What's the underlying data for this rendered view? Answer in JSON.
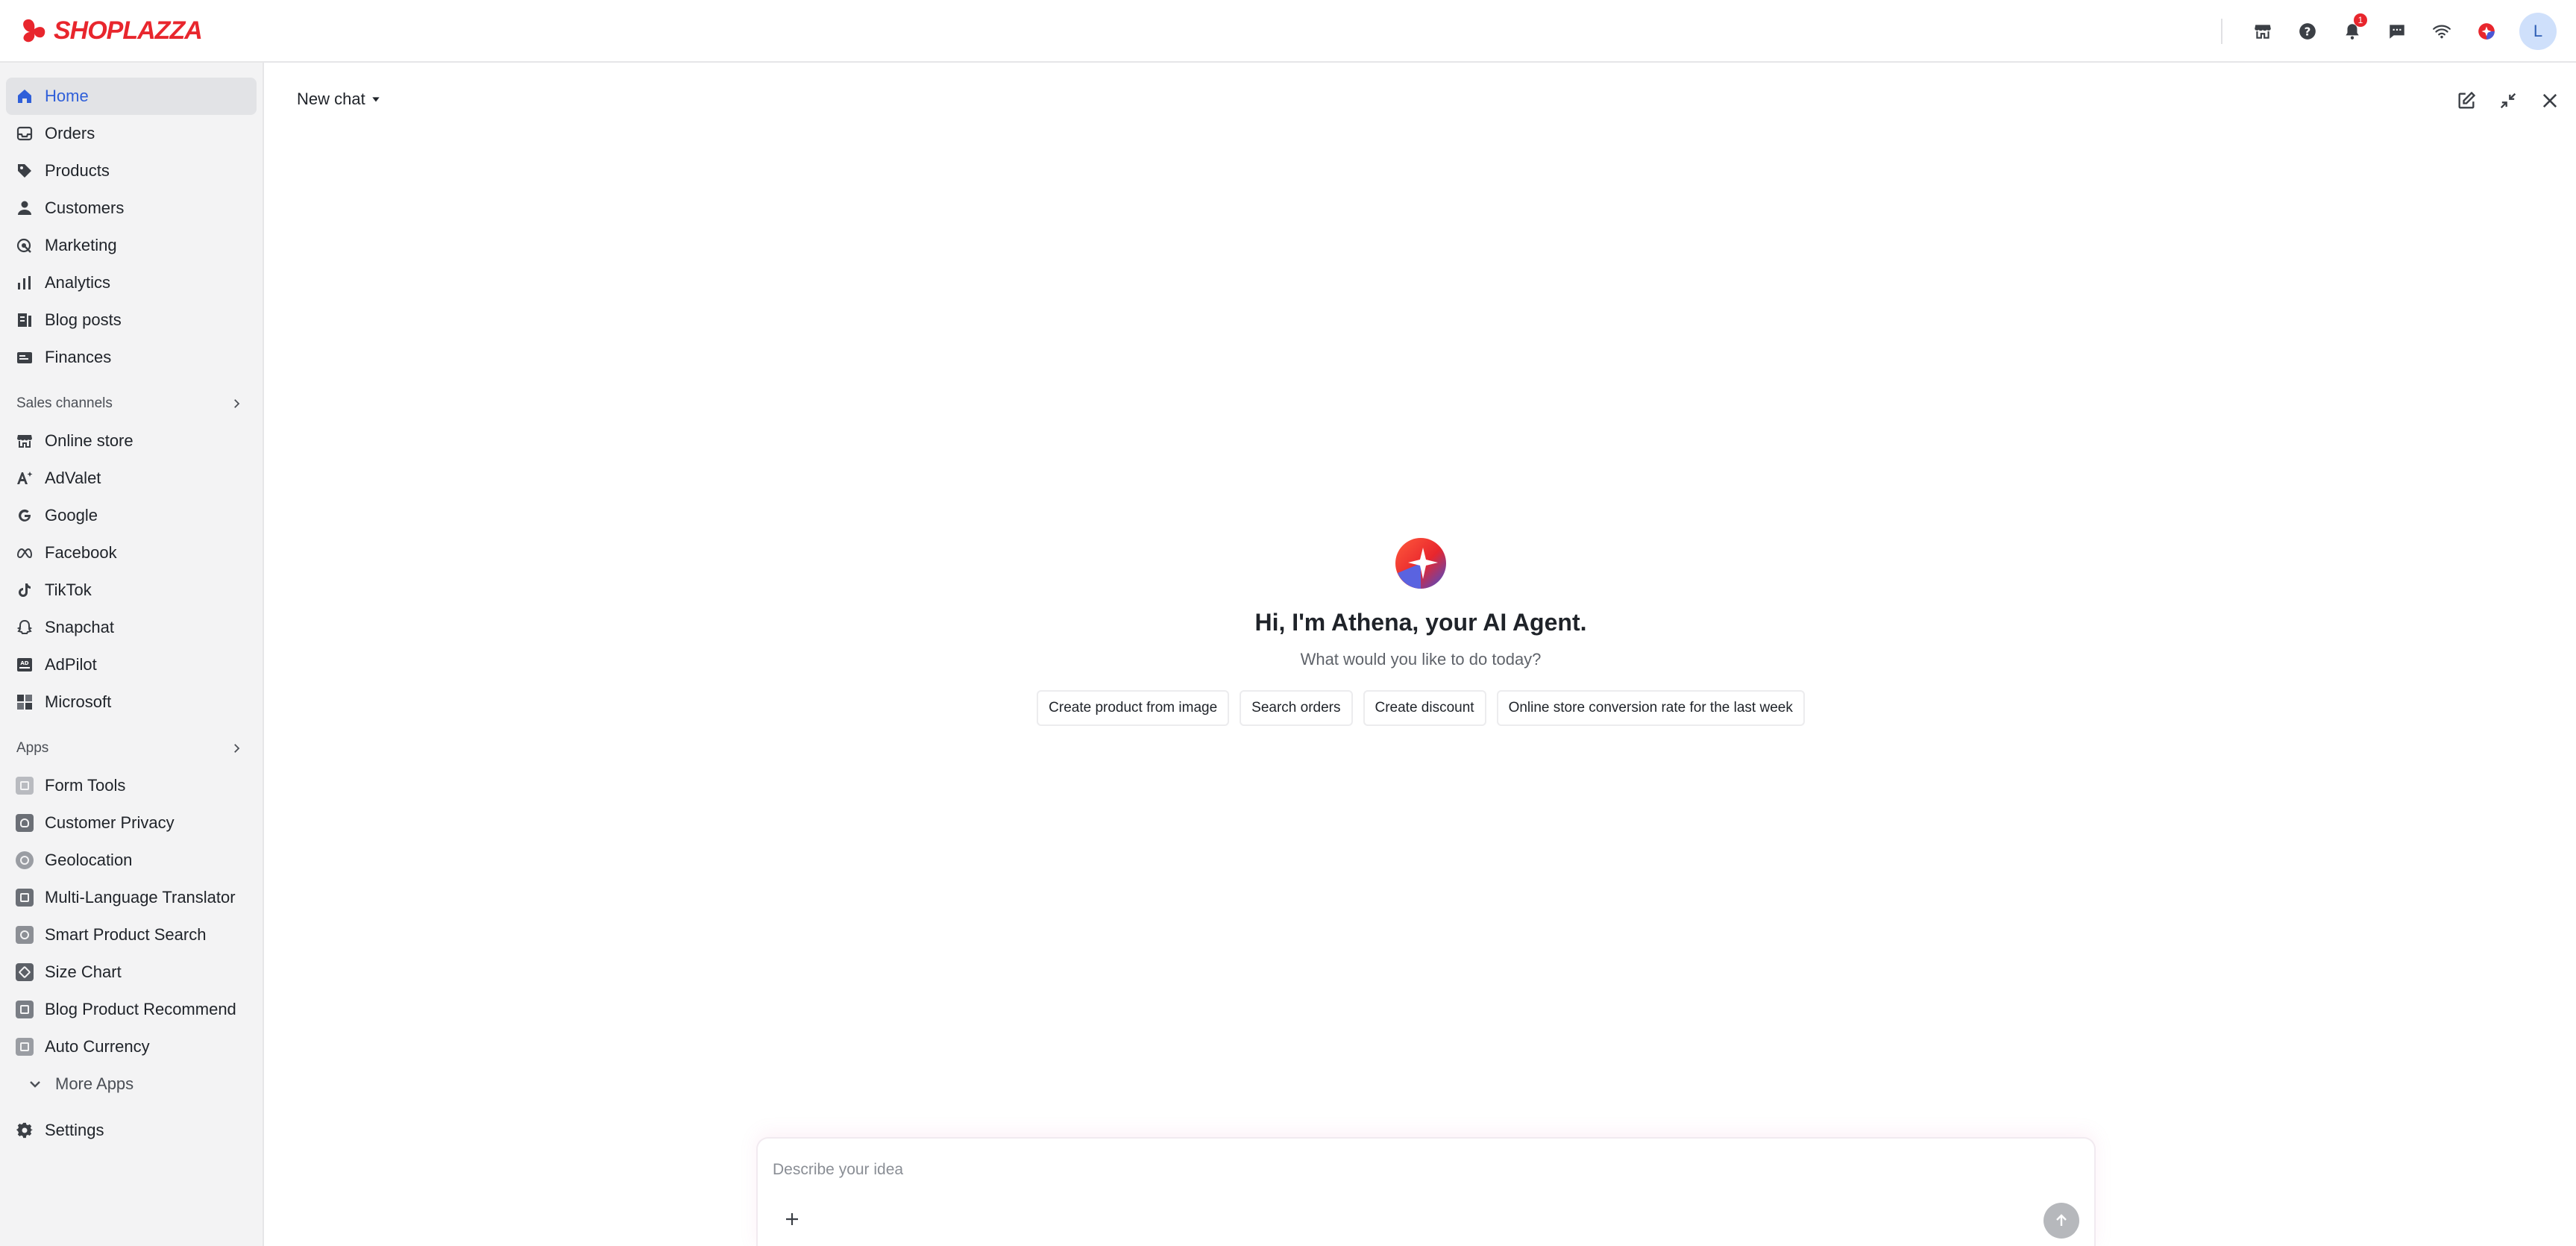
{
  "brand": {
    "name": "SHOPLAZZA",
    "accent": "#e8262d"
  },
  "topbar": {
    "icons": [
      "store-icon",
      "help-icon",
      "bell-icon",
      "chat-icon",
      "wifi-icon",
      "athena-icon"
    ],
    "notification_count": "1",
    "avatar_initial": "L"
  },
  "sidebar": {
    "main_items": [
      {
        "label": "Home",
        "icon": "home-icon",
        "active": true
      },
      {
        "label": "Orders",
        "icon": "inbox-icon"
      },
      {
        "label": "Products",
        "icon": "tag-icon"
      },
      {
        "label": "Customers",
        "icon": "person-icon"
      },
      {
        "label": "Marketing",
        "icon": "target-icon"
      },
      {
        "label": "Analytics",
        "icon": "bar-chart-icon"
      },
      {
        "label": "Blog posts",
        "icon": "blog-icon"
      },
      {
        "label": "Finances",
        "icon": "wallet-icon"
      }
    ],
    "sales_channels_label": "Sales channels",
    "sales_channels": [
      {
        "label": "Online store",
        "icon": "store-icon"
      },
      {
        "label": "AdValet",
        "icon": "ai-icon"
      },
      {
        "label": "Google",
        "icon": "google-icon"
      },
      {
        "label": "Facebook",
        "icon": "meta-icon"
      },
      {
        "label": "TikTok",
        "icon": "tiktok-icon"
      },
      {
        "label": "Snapchat",
        "icon": "ghost-icon"
      },
      {
        "label": "AdPilot",
        "icon": "ad-icon"
      },
      {
        "label": "Microsoft",
        "icon": "microsoft-icon"
      }
    ],
    "apps_label": "Apps",
    "apps": [
      {
        "label": "Form Tools"
      },
      {
        "label": "Customer Privacy"
      },
      {
        "label": "Geolocation"
      },
      {
        "label": "Multi-Language Translator"
      },
      {
        "label": "Smart Product Search"
      },
      {
        "label": "Size Chart"
      },
      {
        "label": "Blog Product Recommend"
      },
      {
        "label": "Auto Currency"
      }
    ],
    "more_apps_label": "More Apps",
    "settings_label": "Settings"
  },
  "main": {
    "chat_title": "New chat",
    "welcome_title": "Hi, I'm Athena, your AI Agent.",
    "welcome_subtitle": "What would you like to do today?",
    "suggestions": [
      "Create product from image",
      "Search orders",
      "Create discount",
      "Online store conversion rate for the last week"
    ],
    "composer": {
      "placeholder": "Describe your idea"
    }
  }
}
